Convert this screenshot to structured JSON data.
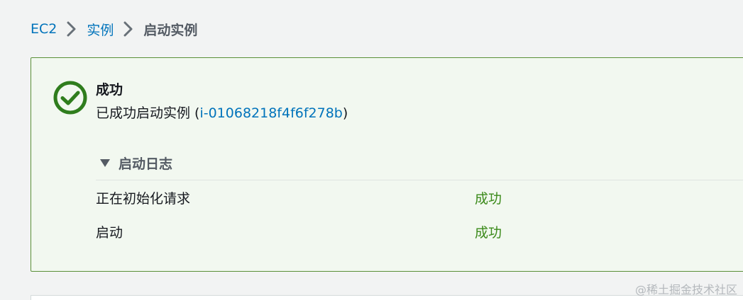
{
  "breadcrumb": {
    "items": [
      {
        "label": "EC2"
      },
      {
        "label": "实例"
      },
      {
        "label": "启动实例"
      }
    ]
  },
  "flash": {
    "type": "success",
    "icon": "check-circle-icon",
    "title": "成功",
    "message_prefix": "已成功启动实例 (",
    "instance_id": "i-01068218f4f6f278b",
    "message_suffix": ")"
  },
  "launch_log": {
    "title": "启动日志",
    "expanded": true,
    "rows": [
      {
        "step": "正在初始化请求",
        "status": "成功"
      },
      {
        "step": "启动",
        "status": "成功"
      }
    ]
  },
  "watermark": "@稀土掘金技术社区",
  "colors": {
    "link": "#0073bb",
    "success": "#3b8a1a",
    "success_border": "#5a8f37",
    "success_bg": "#f2f8f0",
    "page_bg": "#f2f3f3"
  }
}
